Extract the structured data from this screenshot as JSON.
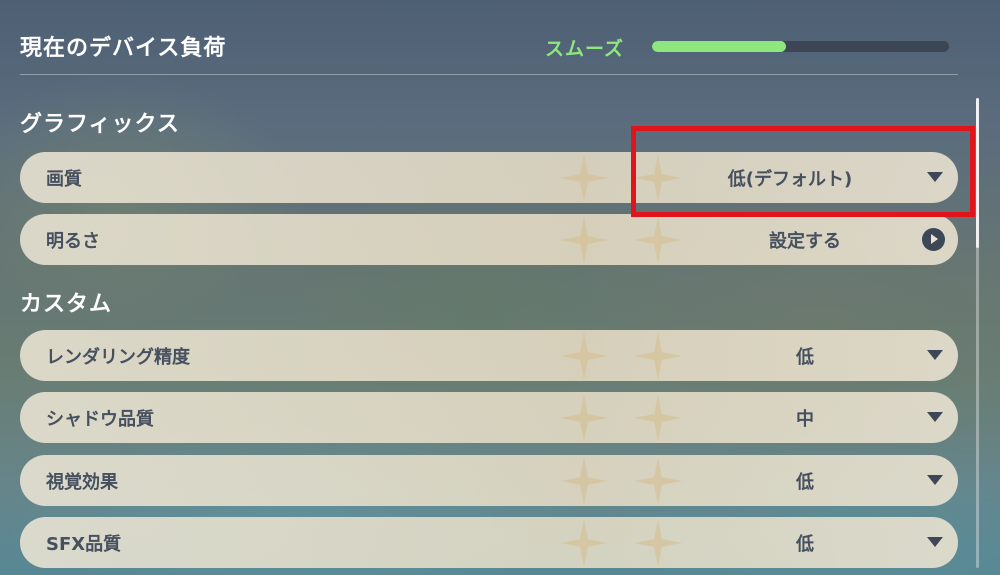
{
  "header": {
    "title": "現在のデバイス負荷",
    "load_status": "スムーズ",
    "load_level": 0.45
  },
  "sections": {
    "graphics_title": "グラフィックス",
    "custom_title": "カスタム"
  },
  "settings": {
    "graphics_quality": {
      "label": "画質",
      "value": "低(デフォルト)"
    },
    "brightness": {
      "label": "明るさ",
      "value": "設定する"
    },
    "render_resolution": {
      "label": "レンダリング精度",
      "value": "低"
    },
    "shadow_quality": {
      "label": "シャドウ品質",
      "value": "中"
    },
    "visual_effects": {
      "label": "視覚効果",
      "value": "低"
    },
    "sfx_quality": {
      "label": "SFX品質",
      "value": "低"
    }
  },
  "icons": {
    "dropdown": "chevron-down-icon",
    "arrow": "arrow-right-icon"
  },
  "colors": {
    "load_status": "#8ee77c",
    "highlight": "#e0141b",
    "row_text": "#46505e"
  }
}
